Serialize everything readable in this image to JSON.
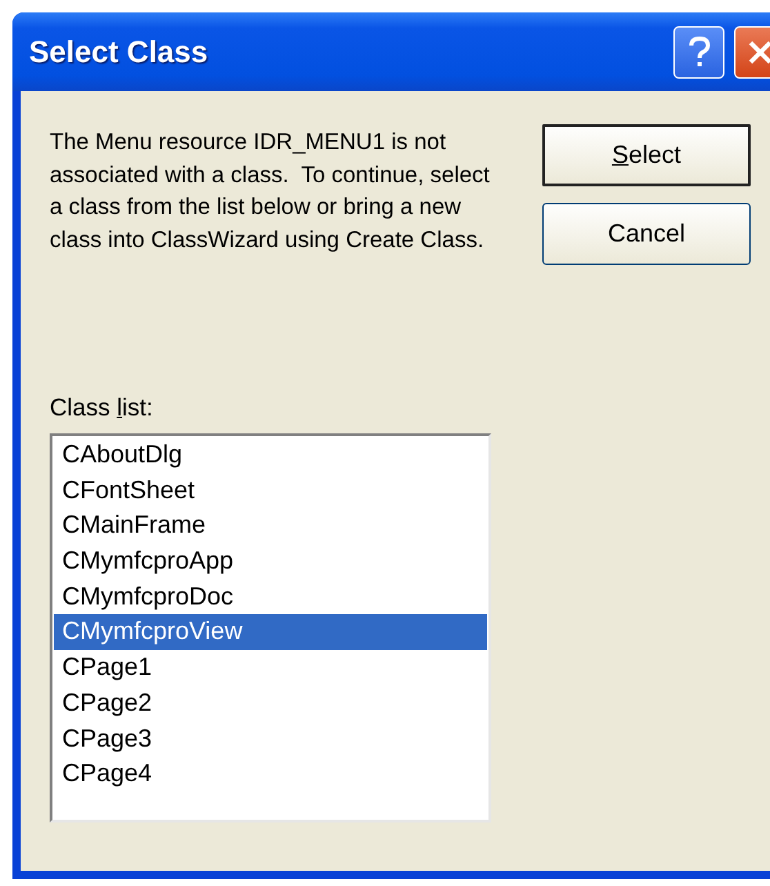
{
  "window": {
    "title": "Select Class"
  },
  "message": "The Menu resource IDR_MENU1 is not associated with a class.  To continue, select a class from the list below or bring a new class into ClassWizard using Create Class.",
  "buttons": [
    {
      "access_key": "S",
      "label_after": "elect",
      "default": true
    },
    {
      "label_before": "Cancel",
      "default": false
    }
  ],
  "class_list": {
    "label_before": "Class ",
    "access_key": "l",
    "label_after": "ist:",
    "items": [
      {
        "label": "CAboutDlg",
        "selected": false
      },
      {
        "label": "CFontSheet",
        "selected": false
      },
      {
        "label": "CMainFrame",
        "selected": false
      },
      {
        "label": "CMymfcproApp",
        "selected": false
      },
      {
        "label": "CMymfcproDoc",
        "selected": false
      },
      {
        "label": "CMymfcproView",
        "selected": true
      },
      {
        "label": "CPage1",
        "selected": false
      },
      {
        "label": "CPage2",
        "selected": false
      },
      {
        "label": "CPage3",
        "selected": false
      },
      {
        "label": "CPage4",
        "selected": false
      }
    ]
  }
}
